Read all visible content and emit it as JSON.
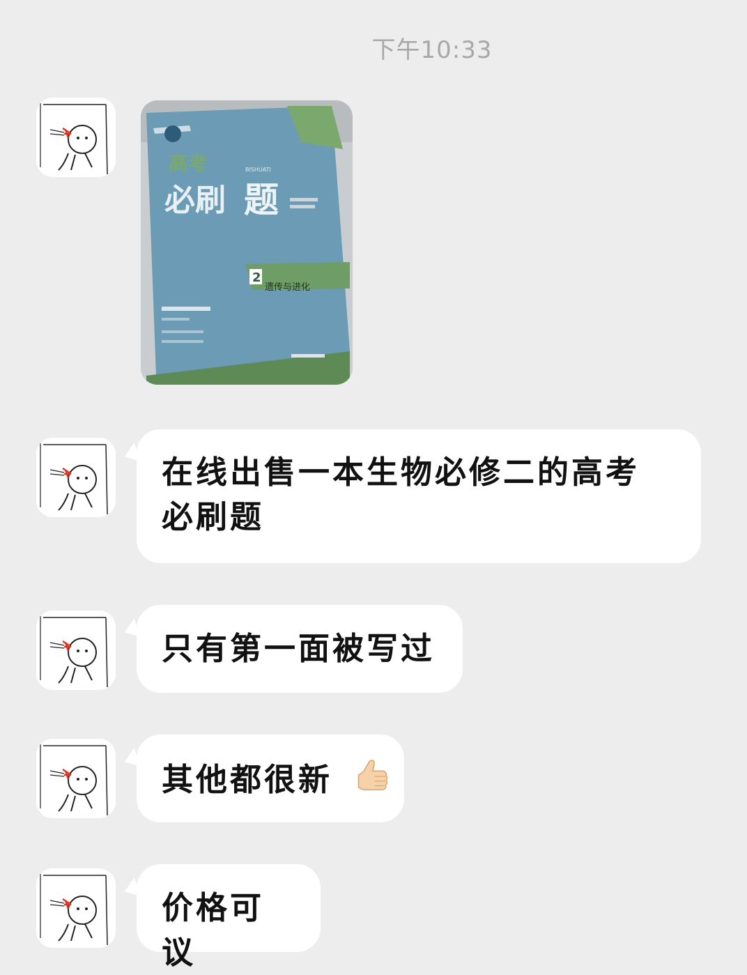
{
  "timestamp": "下午10:33",
  "messages": [
    {
      "type": "image",
      "description_icon": "book-photo"
    },
    {
      "type": "text",
      "line1": "在线出售一本生物必修二的高考",
      "line2": "必刷题"
    },
    {
      "type": "text",
      "text": "只有第一面被写过"
    },
    {
      "type": "text",
      "text": "其他都很新",
      "emoji": "thumbs-up"
    },
    {
      "type": "text",
      "text": "价格可议"
    }
  ],
  "book": {
    "title_small": "高考",
    "title_main": "必刷题",
    "volume": "2",
    "subtitle": "遗传与进化",
    "pinyin": "BISHUATI"
  },
  "colors": {
    "background": "#ededed",
    "bubble": "#ffffff",
    "timestamp": "#a8a8a8",
    "book_blue": "#5b8fb0",
    "book_green": "#6a9a5c"
  }
}
